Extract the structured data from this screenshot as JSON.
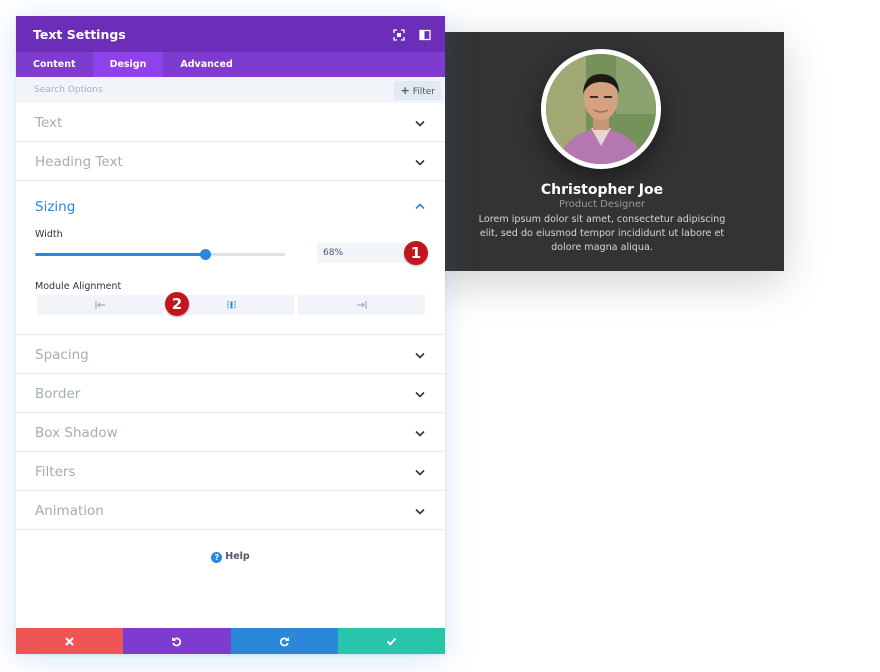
{
  "panel": {
    "title": "Text Settings",
    "icons": {
      "fullscreen": "fullscreen-icon",
      "layout": "split-view-icon"
    },
    "tabs": [
      {
        "label": "Content",
        "active": false
      },
      {
        "label": "Design",
        "active": true
      },
      {
        "label": "Advanced",
        "active": false
      }
    ],
    "search": {
      "placeholder": "Search Options",
      "filter_label": "Filter"
    },
    "groups": {
      "text": "Text",
      "heading_text": "Heading Text",
      "sizing": "Sizing",
      "spacing": "Spacing",
      "border": "Border",
      "box_shadow": "Box Shadow",
      "filters": "Filters",
      "animation": "Animation"
    },
    "sizing": {
      "width_label": "Width",
      "width_value": "68%",
      "width_percent": 68,
      "alignment_label": "Module Alignment",
      "alignment_options": [
        "left",
        "center",
        "right"
      ],
      "alignment_selected": "center"
    },
    "help_label": "Help",
    "footer": [
      "cancel",
      "undo",
      "redo",
      "save"
    ],
    "colors": {
      "header": "#6c2eb9",
      "tabs": "#7e3bd0",
      "accent": "#2b87da",
      "cancel": "#ef5555",
      "save": "#29c4a9"
    }
  },
  "preview": {
    "name": "Christopher Joe",
    "role": "Product Designer",
    "bio": "Lorem ipsum dolor sit amet, consectetur adipiscing elit, sed do eiusmod tempor incididunt ut labore et dolore magna aliqua."
  },
  "markers": {
    "one": "1",
    "two": "2"
  }
}
